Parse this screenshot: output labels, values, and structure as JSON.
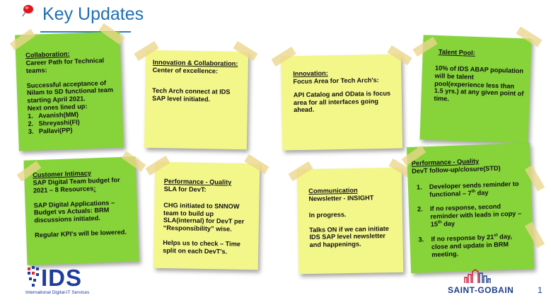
{
  "title": "Key Updates",
  "page_number": "1",
  "logos": {
    "ids_mark": "IDS",
    "ids_subtitle": "International Digital-IT Services",
    "saint_gobain": "SAINT-GOBAIN"
  },
  "notes": {
    "collaboration": {
      "heading": "Collaboration:",
      "subheading": "Career Path for Technical teams:",
      "body": "Successful acceptance of Nilam to SD functional team starting April 2021.",
      "next_line": "Next ones lined up:",
      "items": [
        {
          "num": "1.",
          "text": "Avanish(MM)"
        },
        {
          "num": "2.",
          "text": "Shreyashi(FI)"
        },
        {
          "num": "3.",
          "text": "Pallavi(PP)"
        }
      ]
    },
    "innovation_collab": {
      "heading": "Innovation & Collaboration:",
      "subheading": "Center of excellence:",
      "body": "Tech Arch connect at IDS SAP level initiated."
    },
    "innovation": {
      "heading": "Innovation:",
      "subheading": "Focus Area for Tech Arch's:",
      "body": "API Catalog and OData is focus area for all interfaces going ahead."
    },
    "talent_pool": {
      "heading": "Talent Pool:",
      "body": "10% of IDS ABAP population will be talent pool(experience less than 1.5 yrs.) at any given point of time."
    },
    "customer_intimacy": {
      "heading": "Customer Intimacy",
      "subheading": "SAP Digital Team budget for 2021 – 8 Resources",
      "subheading_suffix": ":",
      "body1": "SAP Digital Applications – Budget vs Actuals: BRM discussions initiated.",
      "body2": "Regular KPI's will be lowered."
    },
    "performance_sla": {
      "heading": "Performance - Quality",
      "subheading": "SLA for DevT:",
      "body1": "CHG initiated to SNNOW team to build up SLA(internal) for DevT per “Responsibility” wise.",
      "body2": "Helps us to check – Time split on each DevT's."
    },
    "communication": {
      "heading": "Communication",
      "subheading": "Newsletter - INSIGHT",
      "body1": "In progress.",
      "body2": "Talks ON if we can initiate IDS SAP level newsletter and happenings."
    },
    "performance_std": {
      "heading": "Performance - Quality",
      "subheading": "DevT follow-up/closure(STD)",
      "items": [
        {
          "num": "1.",
          "pre": "Developer sends reminder to functional – 7",
          "sup": "th",
          "post": " day"
        },
        {
          "num": "2.",
          "pre": "If no response, second reminder with leads in copy – 15",
          "sup": "th",
          "post": " day"
        },
        {
          "num": "3.",
          "pre": "If no response by 21",
          "sup": "st",
          "post": " day, close and update in BRM meeting."
        }
      ]
    }
  },
  "colors": {
    "title": "#1f6fb5",
    "green_note": "#86d33a",
    "yellow_note": "#f3f78a",
    "tape": "#ecd68c",
    "logo_blue": "#1e3c9c"
  }
}
